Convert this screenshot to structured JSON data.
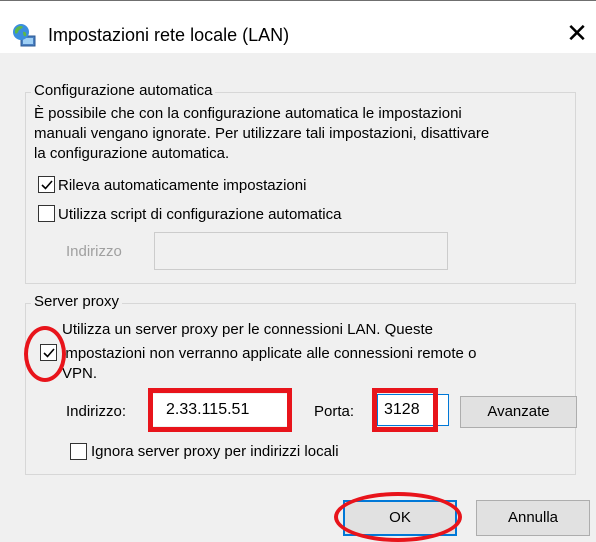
{
  "window": {
    "title": "Impostazioni rete locale (LAN)",
    "close_glyph": "✕",
    "icon": "network-globe-icon"
  },
  "auto_config": {
    "legend": "Configurazione automatica",
    "description_lines": [
      "È possibile che con la configurazione automatica le impostazioni",
      "manuali vengano ignorate. Per utilizzare tali impostazioni, disattivare",
      "la configurazione automatica."
    ],
    "detect_label": "Rileva automaticamente impostazioni",
    "detect_checked": true,
    "script_label": "Utilizza script di configurazione automatica",
    "script_checked": false,
    "address_label": "Indirizzo",
    "address_value": ""
  },
  "proxy": {
    "legend": "Server proxy",
    "use_proxy_lines": [
      "Utilizza un server proxy per le connessioni LAN. Queste",
      "impostazioni non verranno applicate alle connessioni remote o",
      "VPN."
    ],
    "use_proxy_checked": true,
    "address_label": "Indirizzo:",
    "address_value": "2.33.115.51",
    "port_label": "Porta:",
    "port_value": "3128",
    "advanced_label": "Avanzate",
    "bypass_label": "Ignora server proxy per indirizzi locali",
    "bypass_checked": false
  },
  "buttons": {
    "ok_label": "OK",
    "cancel_label": "Annulla"
  },
  "colors": {
    "annotation": "#e8141b",
    "default_button_border": "#0078d7",
    "dialog_bg": "#f0f0f0"
  }
}
